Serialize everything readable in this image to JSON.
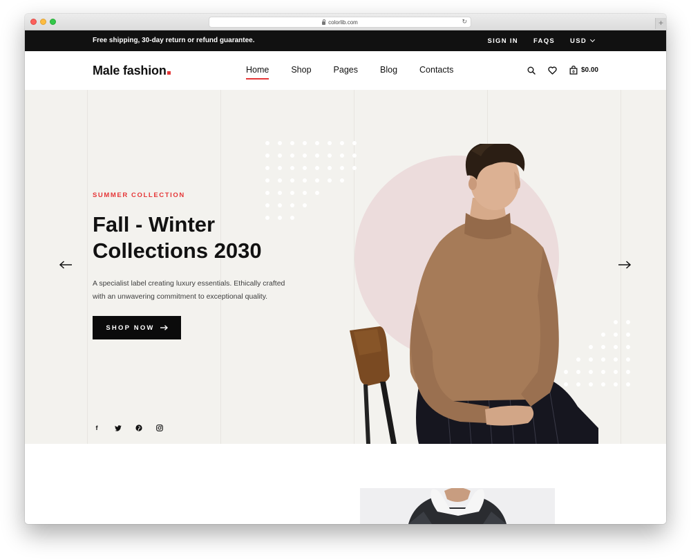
{
  "browser": {
    "url": "colorlib.com"
  },
  "topbar": {
    "promo": "Free shipping, 30-day return or refund guarantee.",
    "sign_in": "SIGN IN",
    "faqs": "FAQS",
    "currency": "USD"
  },
  "header": {
    "logo": "Male fashion",
    "nav": [
      "Home",
      "Shop",
      "Pages",
      "Blog",
      "Contacts"
    ],
    "active_nav": "Home",
    "cart_total": "$0.00"
  },
  "hero": {
    "subtitle": "SUMMER COLLECTION",
    "title_line1": "Fall - Winter",
    "title_line2": "Collections 2030",
    "description_line1": "A specialist label creating luxury essentials. Ethically crafted",
    "description_line2": "with an unwavering commitment to exceptional quality.",
    "cta": "SHOP NOW",
    "social": [
      "facebook-icon",
      "twitter-icon",
      "pinterest-icon",
      "instagram-icon"
    ]
  },
  "colors": {
    "accent": "#e53637",
    "dark": "#111111",
    "hero_bg": "#f3f2ee",
    "circle": "#ecdcdc"
  }
}
